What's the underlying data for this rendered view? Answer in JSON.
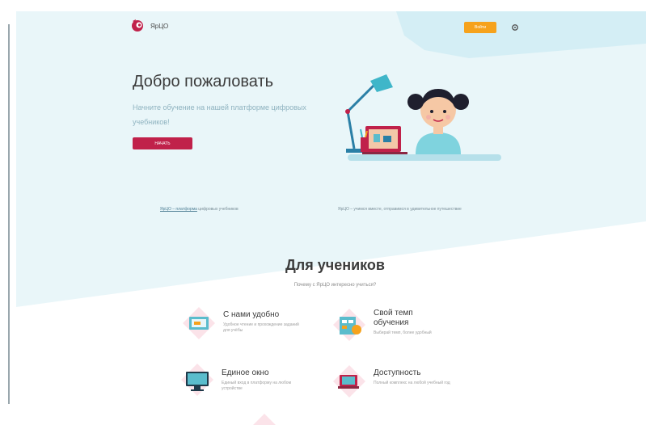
{
  "brand": {
    "name": "ЯрЦО",
    "logo_color": "#c0214a"
  },
  "header": {
    "cta_label": "Войти"
  },
  "hero": {
    "title": "Добро пожаловать",
    "subtitle": "Начните обучение на нашей платформе цифровых учебников!",
    "button_label": "НАЧАТЬ"
  },
  "links": {
    "left_underlined": "ЯрЦО – платформа",
    "left_rest": " цифровых учебников",
    "right": "ЯрЦО – учимся вместе, отправимся в удивительное путешествие"
  },
  "students": {
    "title": "Для учеников",
    "subtitle": "Почему с ЯрЦО интересно учиться?"
  },
  "features": [
    {
      "title": "С нами удобно",
      "desc": "Удобное чтение и прохождение заданий для учёбы"
    },
    {
      "title_line1": "Свой темп",
      "title_line2": "обучения",
      "desc": "Выбирай темп, более удобный"
    },
    {
      "title": "Единое окно",
      "desc": "Единый вход в платформу на любом устройстве"
    },
    {
      "title": "Доступность",
      "desc": "Полный комплекс на любой учебный год"
    }
  ],
  "colors": {
    "hero_bg": "#e9f6f9",
    "hero_accent": "#d4eef5",
    "primary_button": "#c0214a",
    "cta_orange": "#f6a21c"
  },
  "icons": {
    "settings": "settings-icon",
    "lamp": "lamp-illustration",
    "girl": "girl-illustration"
  }
}
